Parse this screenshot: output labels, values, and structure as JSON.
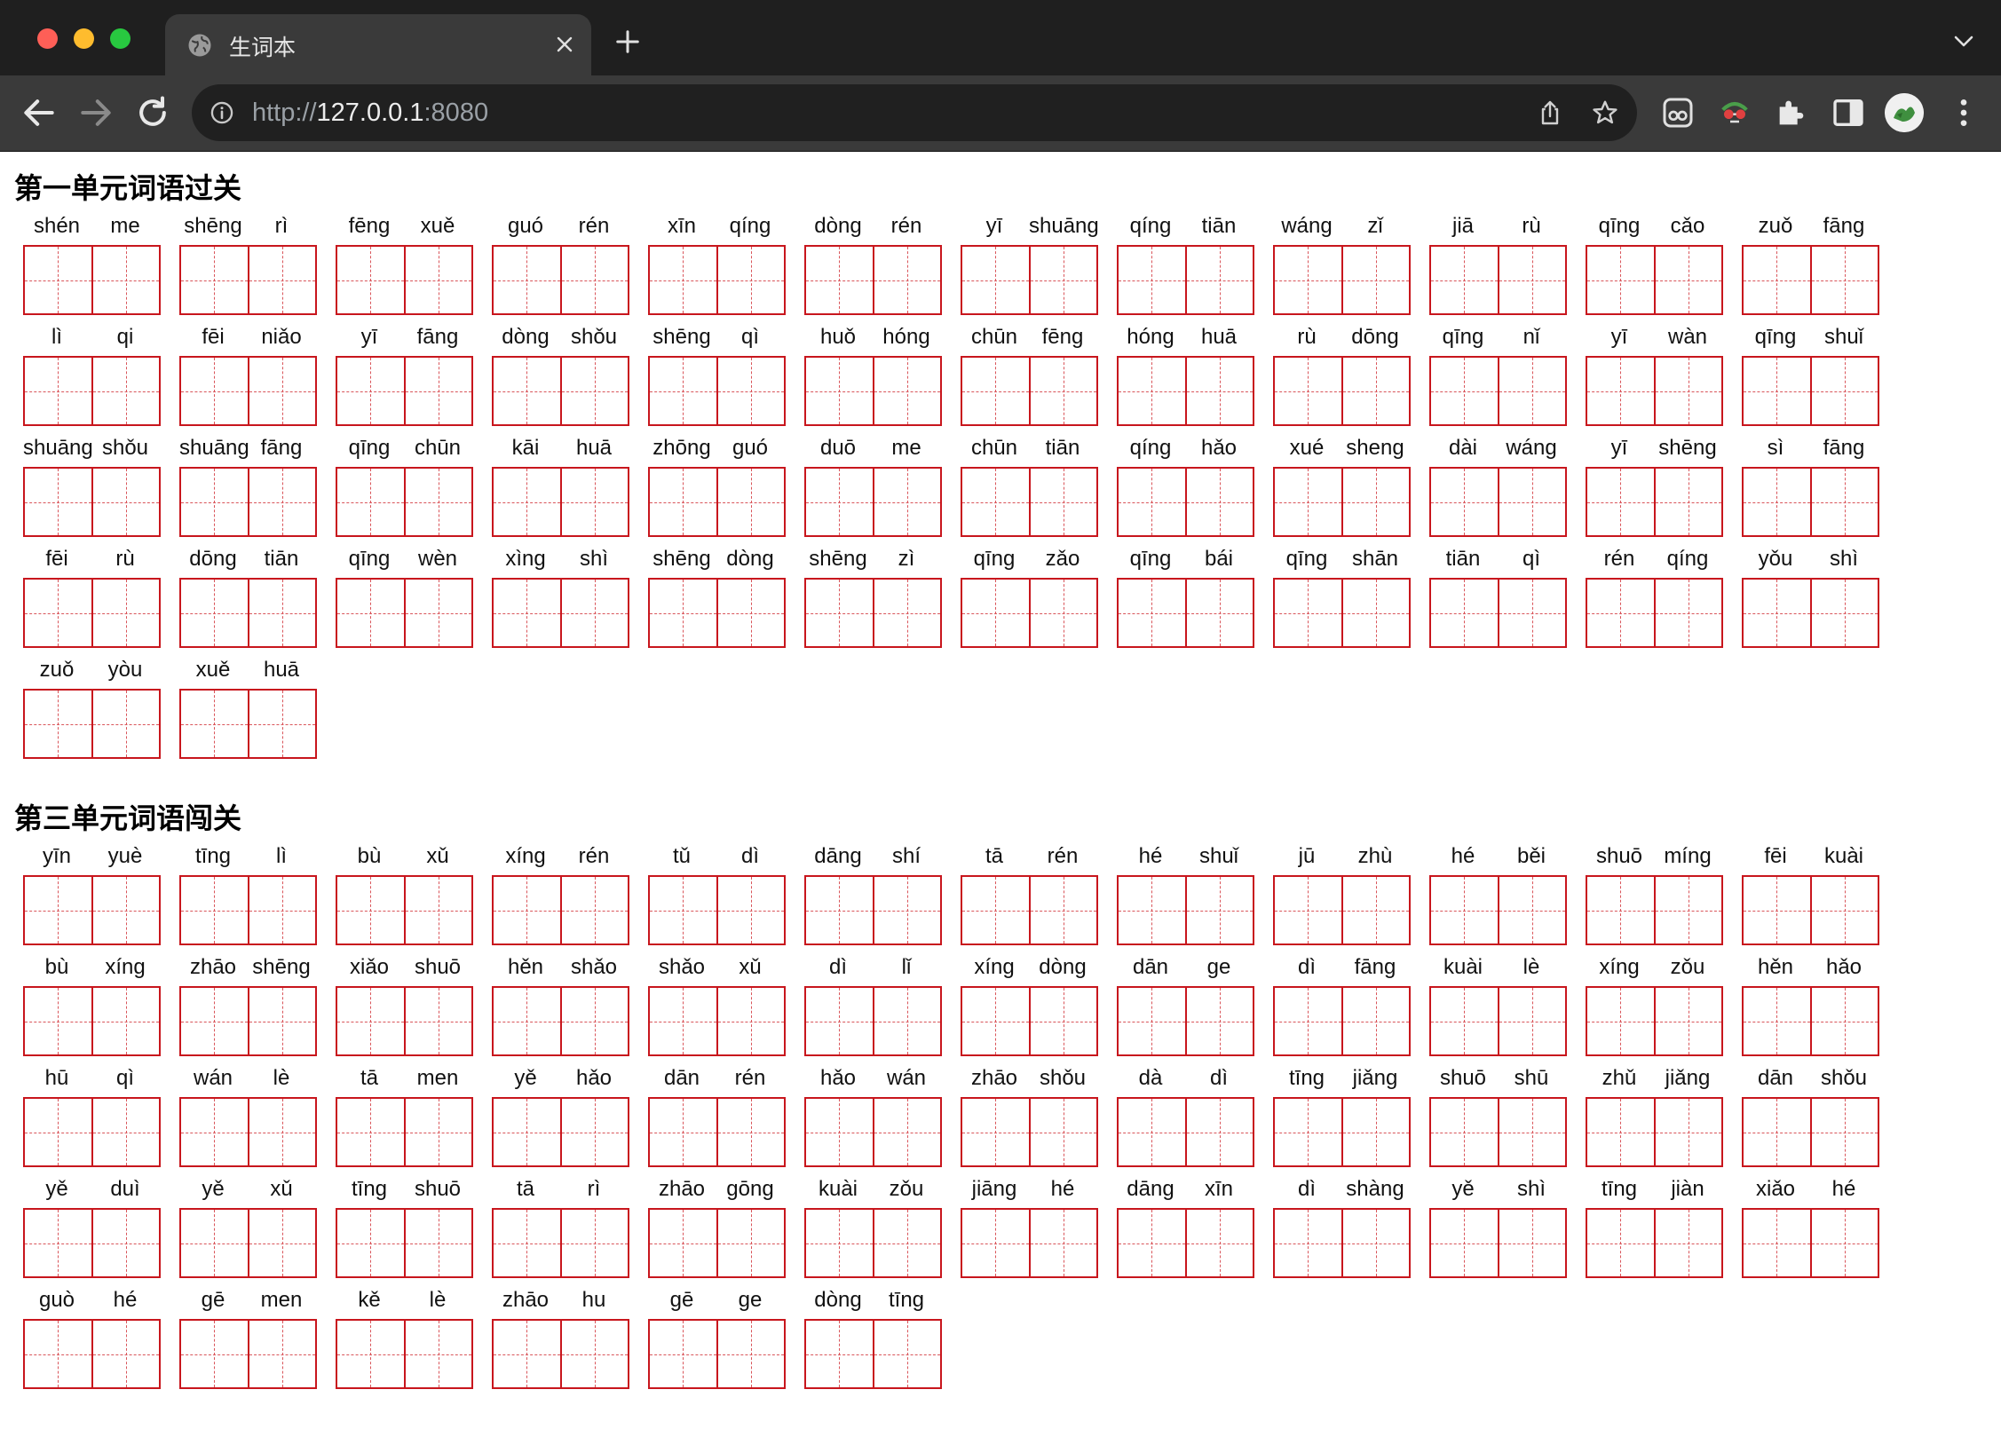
{
  "browser": {
    "tab_title": "生词本",
    "url_scheme": "http://",
    "url_host": "127.0.0.1",
    "url_port": ":8080"
  },
  "sections": [
    {
      "title": "第一单元词语过关",
      "words": [
        [
          "shén",
          "me"
        ],
        [
          "shēng",
          "rì"
        ],
        [
          "fēng",
          "xuě"
        ],
        [
          "guó",
          "rén"
        ],
        [
          "xīn",
          "qíng"
        ],
        [
          "dòng",
          "rén"
        ],
        [
          "yī",
          "shuāng"
        ],
        [
          "qíng",
          "tiān"
        ],
        [
          "wáng",
          "zǐ"
        ],
        [
          "jiā",
          "rù"
        ],
        [
          "qīng",
          "cǎo"
        ],
        [
          "zuǒ",
          "fāng"
        ],
        [
          "lì",
          "qi"
        ],
        [
          "fēi",
          "niǎo"
        ],
        [
          "yī",
          "fāng"
        ],
        [
          "dòng",
          "shǒu"
        ],
        [
          "shēng",
          "qì"
        ],
        [
          "huǒ",
          "hóng"
        ],
        [
          "chūn",
          "fēng"
        ],
        [
          "hóng",
          "huā"
        ],
        [
          "rù",
          "dōng"
        ],
        [
          "qīng",
          "nǐ"
        ],
        [
          "yī",
          "wàn"
        ],
        [
          "qīng",
          "shuǐ"
        ],
        [
          "shuāng",
          "shǒu"
        ],
        [
          "shuāng",
          "fāng"
        ],
        [
          "qīng",
          "chūn"
        ],
        [
          "kāi",
          "huā"
        ],
        [
          "zhōng",
          "guó"
        ],
        [
          "duō",
          "me"
        ],
        [
          "chūn",
          "tiān"
        ],
        [
          "qíng",
          "hǎo"
        ],
        [
          "xué",
          "sheng"
        ],
        [
          "dài",
          "wáng"
        ],
        [
          "yī",
          "shēng"
        ],
        [
          "sì",
          "fāng"
        ],
        [
          "fēi",
          "rù"
        ],
        [
          "dōng",
          "tiān"
        ],
        [
          "qīng",
          "wèn"
        ],
        [
          "xìng",
          "shì"
        ],
        [
          "shēng",
          "dòng"
        ],
        [
          "shēng",
          "zì"
        ],
        [
          "qīng",
          "zǎo"
        ],
        [
          "qīng",
          "bái"
        ],
        [
          "qīng",
          "shān"
        ],
        [
          "tiān",
          "qì"
        ],
        [
          "rén",
          "qíng"
        ],
        [
          "yǒu",
          "shì"
        ],
        [
          "zuǒ",
          "yòu"
        ],
        [
          "xuě",
          "huā"
        ]
      ]
    },
    {
      "title": "第三单元词语闯关",
      "words": [
        [
          "yīn",
          "yuè"
        ],
        [
          "tīng",
          "lì"
        ],
        [
          "bù",
          "xǔ"
        ],
        [
          "xíng",
          "rén"
        ],
        [
          "tǔ",
          "dì"
        ],
        [
          "dāng",
          "shí"
        ],
        [
          "tā",
          "rén"
        ],
        [
          "hé",
          "shuǐ"
        ],
        [
          "jū",
          "zhù"
        ],
        [
          "hé",
          "běi"
        ],
        [
          "shuō",
          "míng"
        ],
        [
          "fēi",
          "kuài"
        ],
        [
          "bù",
          "xíng"
        ],
        [
          "zhāo",
          "shēng"
        ],
        [
          "xiǎo",
          "shuō"
        ],
        [
          "hěn",
          "shǎo"
        ],
        [
          "shǎo",
          "xǔ"
        ],
        [
          "dì",
          "lǐ"
        ],
        [
          "xíng",
          "dòng"
        ],
        [
          "dān",
          "ge"
        ],
        [
          "dì",
          "fāng"
        ],
        [
          "kuài",
          "lè"
        ],
        [
          "xíng",
          "zǒu"
        ],
        [
          "hěn",
          "hǎo"
        ],
        [
          "hū",
          "qì"
        ],
        [
          "wán",
          "lè"
        ],
        [
          "tā",
          "men"
        ],
        [
          "yě",
          "hǎo"
        ],
        [
          "dān",
          "rén"
        ],
        [
          "hǎo",
          "wán"
        ],
        [
          "zhāo",
          "shǒu"
        ],
        [
          "dà",
          "dì"
        ],
        [
          "tīng",
          "jiǎng"
        ],
        [
          "shuō",
          "shū"
        ],
        [
          "zhǔ",
          "jiǎng"
        ],
        [
          "dān",
          "shǒu"
        ],
        [
          "yě",
          "duì"
        ],
        [
          "yě",
          "xǔ"
        ],
        [
          "tīng",
          "shuō"
        ],
        [
          "tā",
          "rì"
        ],
        [
          "zhāo",
          "gōng"
        ],
        [
          "kuài",
          "zǒu"
        ],
        [
          "jiāng",
          "hé"
        ],
        [
          "dāng",
          "xīn"
        ],
        [
          "dì",
          "shàng"
        ],
        [
          "yě",
          "shì"
        ],
        [
          "tīng",
          "jiàn"
        ],
        [
          "xiǎo",
          "hé"
        ],
        [
          "guò",
          "hé"
        ],
        [
          "gē",
          "men"
        ],
        [
          "kě",
          "lè"
        ],
        [
          "zhāo",
          "hu"
        ],
        [
          "gē",
          "ge"
        ],
        [
          "dòng",
          "tīng"
        ]
      ]
    }
  ],
  "icons": [
    "globe-icon",
    "close-icon",
    "plus-icon",
    "chevron-down-icon",
    "back-arrow-icon",
    "forward-arrow-icon",
    "reload-icon",
    "info-icon",
    "share-icon",
    "star-icon",
    "extension-icon",
    "puzzle-icon",
    "sidepanel-icon",
    "avatar",
    "more-vert-icon"
  ]
}
